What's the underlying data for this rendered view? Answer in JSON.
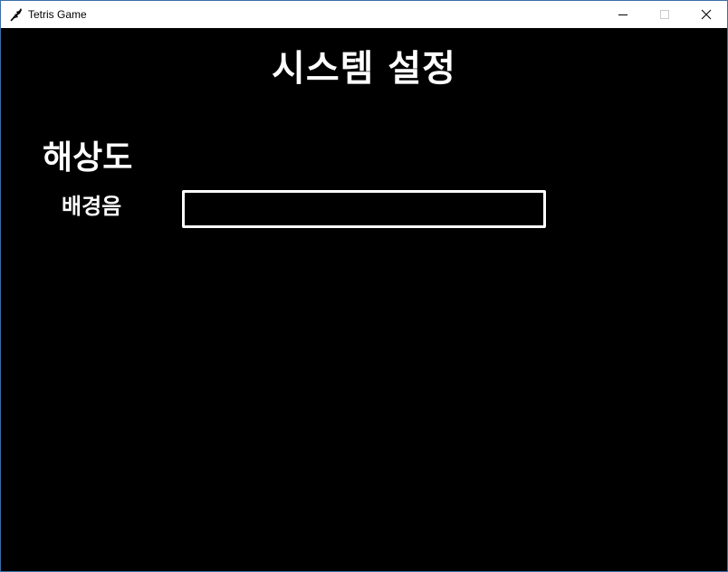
{
  "window": {
    "title": "Tetris Game",
    "icon": "tetris-feather-icon",
    "controls": [
      "minimize-icon",
      "maximize-icon",
      "close-icon"
    ]
  },
  "screen": {
    "heading": "시스템 설정",
    "options": {
      "resolution_label": "해상도",
      "bgm_label": "배경음"
    }
  },
  "colors": {
    "background": "#000000",
    "text": "#ffffff",
    "titlebar": "#ffffff"
  }
}
